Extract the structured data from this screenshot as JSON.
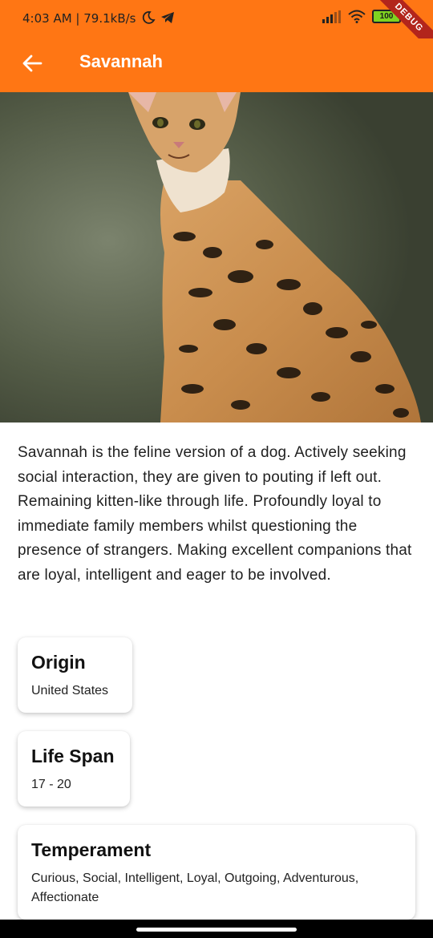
{
  "status_bar": {
    "time_speed": "4:03 AM | 79.1kB/s",
    "battery": "100",
    "icons": [
      "moon-icon",
      "telegram-icon",
      "signal-icon",
      "wifi-icon",
      "battery-icon"
    ]
  },
  "debug_banner": "DEBUG",
  "app_bar": {
    "title": "Savannah",
    "back_icon": "arrow-left-icon",
    "color": "#ff7614"
  },
  "hero_image": {
    "subject": "savannah-cat-photo"
  },
  "description": "Savannah is the feline version of a dog. Actively seeking social interaction, they are given to pouting if left out. Remaining kitten-like through life. Profoundly loyal to immediate family members whilst questioning the presence of strangers. Making excellent companions that are loyal, intelligent and eager to be involved.",
  "details": {
    "origin": {
      "label": "Origin",
      "value": "United States"
    },
    "life_span": {
      "label": "Life Span",
      "value": "17 - 20"
    },
    "temperament": {
      "label": "Temperament",
      "value": "Curious, Social, Intelligent, Loyal, Outgoing, Adventurous, Affectionate"
    }
  }
}
